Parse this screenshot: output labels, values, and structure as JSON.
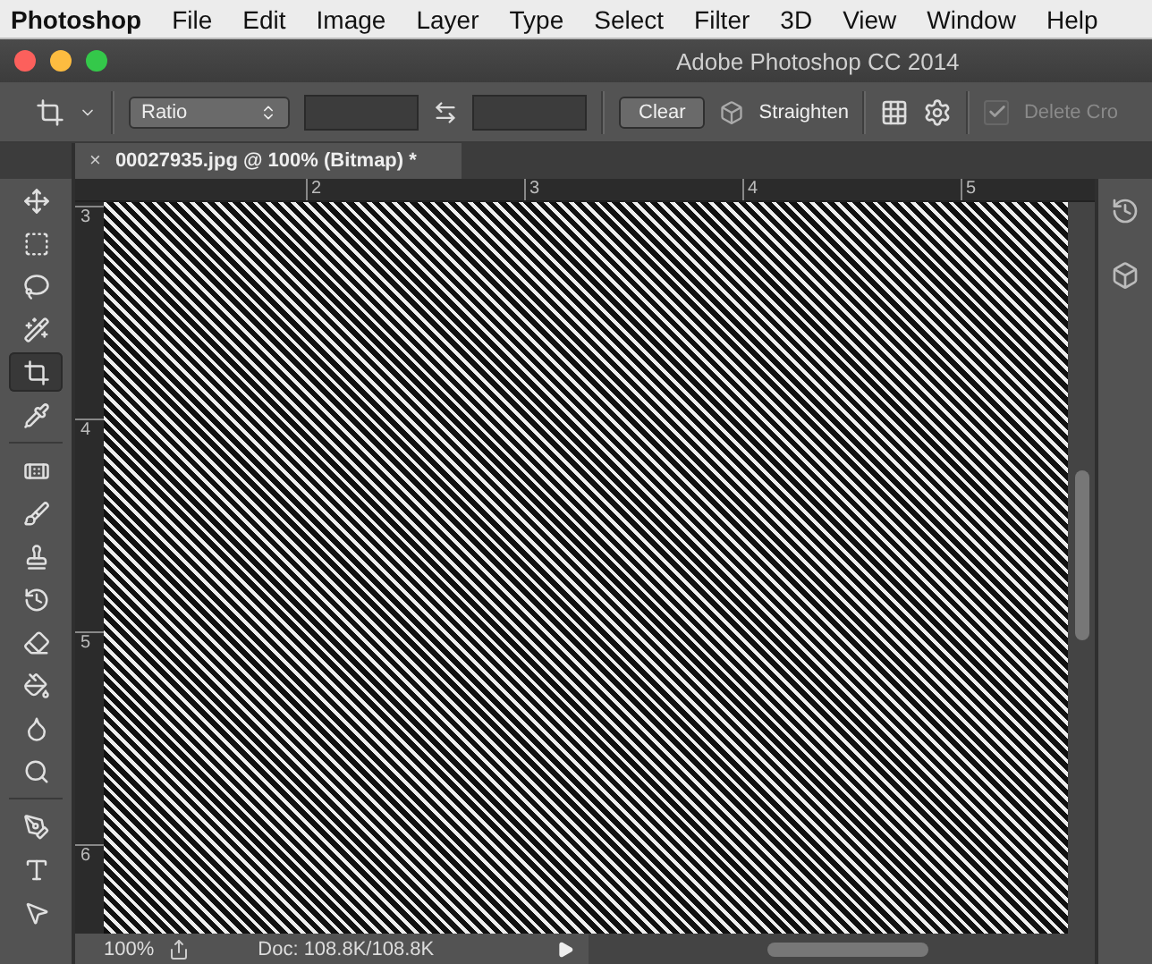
{
  "menu_bar": {
    "app": "Photoshop",
    "items": [
      "File",
      "Edit",
      "Image",
      "Layer",
      "Type",
      "Select",
      "Filter",
      "3D",
      "View",
      "Window",
      "Help"
    ]
  },
  "window": {
    "title": "Adobe Photoshop CC 2014"
  },
  "options_bar": {
    "ratio_select": "Ratio",
    "clear_button": "Clear",
    "straighten_button": "Straighten",
    "delete_crop": {
      "label": "Delete Cro",
      "checked": true,
      "disabled": true
    }
  },
  "document_tab": {
    "close": "×",
    "title": "00027935.jpg @ 100% (Bitmap) *"
  },
  "rulers": {
    "horizontal": [
      "2",
      "3",
      "4",
      "5"
    ],
    "vertical": [
      "3",
      "4",
      "5",
      "6"
    ]
  },
  "tool_groups": [
    {
      "tools": [
        {
          "kind": "move",
          "selected": false
        },
        {
          "kind": "marquee",
          "selected": false
        },
        {
          "kind": "lasso",
          "selected": false
        },
        {
          "kind": "wand",
          "selected": false
        },
        {
          "kind": "crop",
          "selected": true
        },
        {
          "kind": "eyedropper",
          "selected": false
        }
      ]
    },
    {
      "tools": [
        {
          "kind": "healing",
          "selected": false
        },
        {
          "kind": "brush",
          "selected": false
        },
        {
          "kind": "stamp",
          "selected": false
        },
        {
          "kind": "history",
          "selected": false
        },
        {
          "kind": "eraser",
          "selected": false
        },
        {
          "kind": "bucket",
          "selected": false
        },
        {
          "kind": "blur",
          "selected": false
        },
        {
          "kind": "dodge",
          "selected": false
        }
      ]
    },
    {
      "tools": [
        {
          "kind": "pen",
          "selected": false
        },
        {
          "kind": "type",
          "selected": false
        },
        {
          "kind": "path",
          "selected": false
        }
      ]
    }
  ],
  "status_bar": {
    "zoom": "100%",
    "doc": "Doc: 108.8K/108.8K"
  }
}
